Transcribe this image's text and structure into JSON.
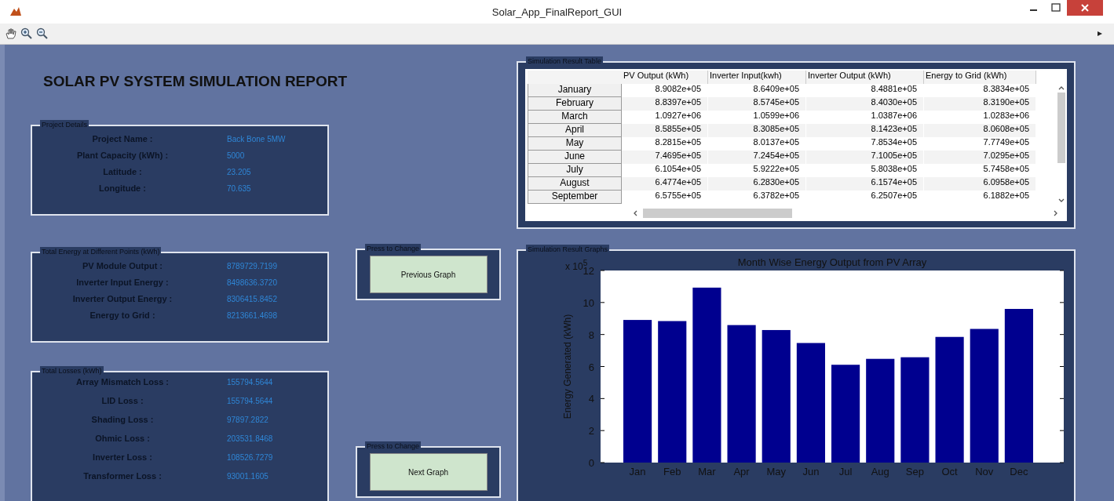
{
  "window": {
    "title": "Solar_App_FinalReport_GUI"
  },
  "report_title": "SOLAR PV SYSTEM SIMULATION REPORT",
  "project_details": {
    "title": "Project Details",
    "rows": [
      {
        "label": "Project Name :",
        "value": "Back Bone 5MW"
      },
      {
        "label": "Plant Capacity (kWh) :",
        "value": "5000"
      },
      {
        "label": "Latitude :",
        "value": "23.205"
      },
      {
        "label": "Longitude :",
        "value": "70.635"
      }
    ]
  },
  "energy_points": {
    "title": "Total Energy at Different Points (kWh)",
    "rows": [
      {
        "label": "PV Module Output :",
        "value": "8789729.7199"
      },
      {
        "label": "Inverter Input Energy :",
        "value": "8498636.3720"
      },
      {
        "label": "Inverter Output Energy :",
        "value": "8306415.8452"
      },
      {
        "label": "Energy to Grid :",
        "value": "8213661.4698"
      }
    ]
  },
  "losses": {
    "title": "Total Losses (kWh)",
    "rows": [
      {
        "label": "Array Mismatch  Loss :",
        "value": "155794.5644"
      },
      {
        "label": "LID Loss :",
        "value": "155794.5644"
      },
      {
        "label": "Shading Loss :",
        "value": "97897.2822"
      },
      {
        "label": "Ohmic Loss :",
        "value": "203531.8468"
      },
      {
        "label": "Inverter Loss :",
        "value": "108526.7279"
      },
      {
        "label": "Transformer Loss :",
        "value": "93001.1605"
      }
    ]
  },
  "previous_panel": {
    "title": "Press to Change",
    "button": "Previous Graph"
  },
  "next_panel": {
    "title": "Press to Change",
    "button": "Next Graph"
  },
  "table_panel": {
    "title": "Simulation Result Table",
    "columns": [
      "PV Output (kWh)",
      "Inverter Input(kwh)",
      "Inverter Output  (kWh)",
      "Energy to Grid (kWh)"
    ],
    "rows": [
      {
        "header": "January",
        "cells": [
          "8.9082e+05",
          "8.6409e+05",
          "8.4881e+05",
          "8.3834e+05"
        ]
      },
      {
        "header": "February",
        "cells": [
          "8.8397e+05",
          "8.5745e+05",
          "8.4030e+05",
          "8.3190e+05"
        ]
      },
      {
        "header": "March",
        "cells": [
          "1.0927e+06",
          "1.0599e+06",
          "1.0387e+06",
          "1.0283e+06"
        ]
      },
      {
        "header": "April",
        "cells": [
          "8.5855e+05",
          "8.3085e+05",
          "8.1423e+05",
          "8.0608e+05"
        ]
      },
      {
        "header": "May",
        "cells": [
          "8.2815e+05",
          "8.0137e+05",
          "7.8534e+05",
          "7.7749e+05"
        ]
      },
      {
        "header": "June",
        "cells": [
          "7.4695e+05",
          "7.2454e+05",
          "7.1005e+05",
          "7.0295e+05"
        ]
      },
      {
        "header": "July",
        "cells": [
          "6.1054e+05",
          "5.9222e+05",
          "5.8038e+05",
          "5.7458e+05"
        ]
      },
      {
        "header": "August",
        "cells": [
          "6.4774e+05",
          "6.2830e+05",
          "6.1574e+05",
          "6.0958e+05"
        ]
      },
      {
        "header": "September",
        "cells": [
          "6.5755e+05",
          "6.3782e+05",
          "6.2507e+05",
          "6.1882e+05"
        ]
      }
    ]
  },
  "graph_panel": {
    "title": "Simulation Result Graphs",
    "axis_multiplier": "x 10$^{5}$",
    "chart_data": {
      "type": "bar",
      "title": "Month Wise Energy Output from PV Array",
      "ylabel": "Energy Generated (kWh)",
      "categories": [
        "Jan",
        "Feb",
        "Mar",
        "Apr",
        "May",
        "Jun",
        "Jul",
        "Aug",
        "Sep",
        "Oct",
        "Nov",
        "Dec"
      ],
      "values": [
        8.91,
        8.84,
        10.93,
        8.59,
        8.28,
        7.47,
        6.11,
        6.48,
        6.58,
        7.85,
        8.35,
        9.6
      ],
      "ylim": [
        0,
        12
      ],
      "yticks": [
        0,
        2,
        4,
        6,
        8,
        10,
        12
      ]
    }
  }
}
